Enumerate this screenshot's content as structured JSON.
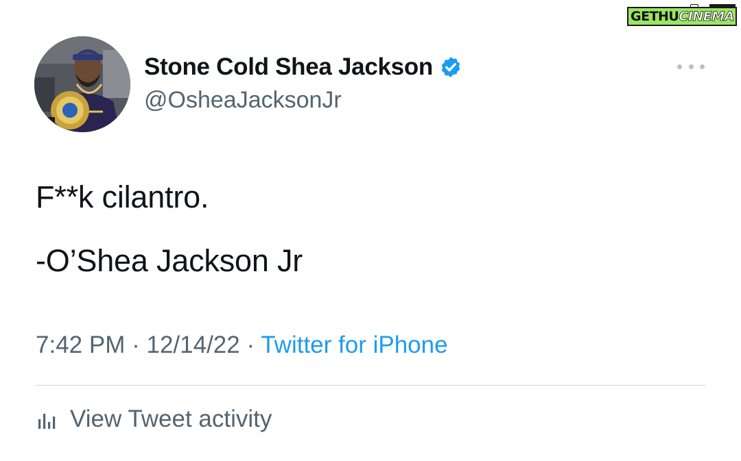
{
  "watermark": {
    "part1": "GETHU",
    "part2": "CINEMA"
  },
  "tweet": {
    "display_name": "Stone Cold Shea Jackson",
    "handle": "@OsheaJacksonJr",
    "verified": true,
    "text_lines": [
      "F**k cilantro.",
      "-O’Shea Jackson Jr"
    ],
    "time": "7:42 PM",
    "separator": "·",
    "date": "12/14/22",
    "source": "Twitter for iPhone"
  },
  "actions": {
    "view_activity_label": "View Tweet activity"
  },
  "icons": {
    "avatar": "profile-photo",
    "verified": "verified-badge-icon",
    "more": "more-options-icon",
    "activity": "bar-chart-icon"
  },
  "colors": {
    "text_primary": "#0f1419",
    "text_secondary": "#536471",
    "link_blue": "#1d9bf0",
    "verified_blue": "#1d9bf0",
    "divider": "#d6dadd",
    "watermark_green": "#9be564"
  }
}
